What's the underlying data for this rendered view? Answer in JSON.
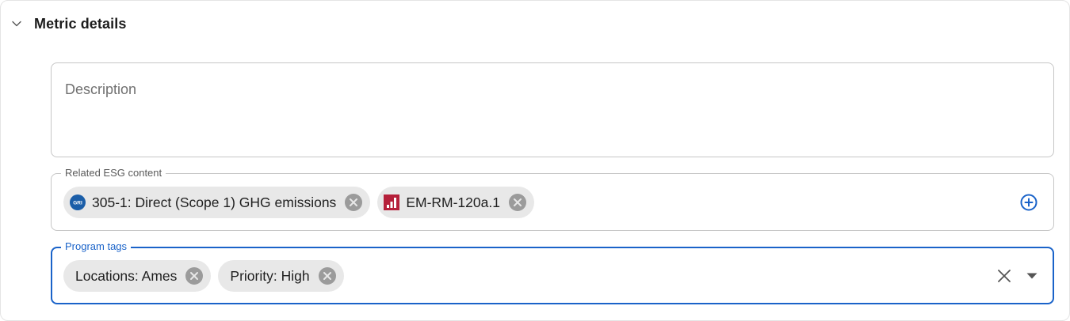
{
  "section": {
    "title": "Metric details",
    "toggle_icon": "chevron-down-icon"
  },
  "description": {
    "placeholder": "Description",
    "value": ""
  },
  "related_esg": {
    "label": "Related ESG content",
    "chips": [
      {
        "label": "305-1: Direct (Scope 1) GHG emissions",
        "icon": "gri-logo-icon",
        "icon_text": "GRI",
        "color": "#1b5ea8"
      },
      {
        "label": "EM-RM-120a.1",
        "icon": "sasb-logo-icon",
        "color": "#b5203a"
      }
    ],
    "add_icon": "plus-circle-icon"
  },
  "program_tags": {
    "label": "Program tags",
    "chips": [
      {
        "label": "Locations: Ames"
      },
      {
        "label": "Priority: High"
      }
    ],
    "clear_icon": "close-icon",
    "dropdown_icon": "caret-down-icon"
  },
  "colors": {
    "accent": "#1a63c9",
    "chip_bg": "#e8e8e8",
    "chip_remove": "#9b9b9b",
    "border": "#c6c6c6"
  }
}
